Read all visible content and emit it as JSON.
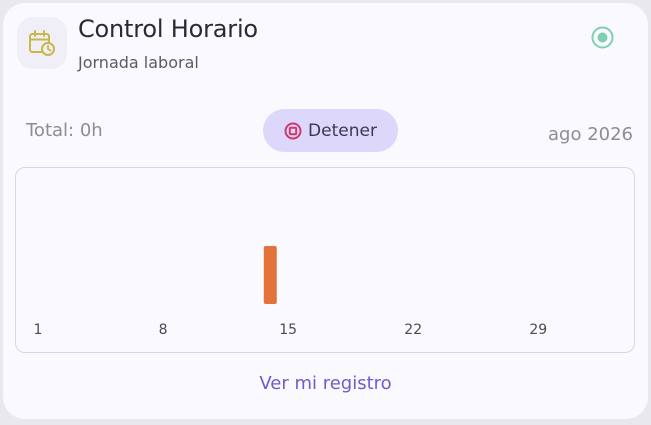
{
  "header": {
    "title": "Control Horario",
    "subtitle": "Jornada laboral"
  },
  "icons": {
    "calendar": "calendar-clock-icon",
    "status": "active-status-icon",
    "stop": "stop-icon"
  },
  "summary": {
    "total": "Total: 0h",
    "stop_label": "Detener",
    "month": "ago 2026"
  },
  "colors": {
    "accent": "#6e5ccf",
    "status": "#7fcfb1",
    "calendar": "#c9b74a",
    "stop": "#d1386b",
    "bar": "#e2743b",
    "button_bg": "#dcd7fb"
  },
  "chart_data": {
    "type": "bar",
    "x": [
      14
    ],
    "values": [
      1
    ],
    "xlim": [
      1,
      31
    ],
    "xticks": [
      "1",
      "8",
      "15",
      "22",
      "29"
    ],
    "ylabel": "",
    "xlabel": ""
  },
  "footer": {
    "link_label": "Ver mi registro"
  }
}
